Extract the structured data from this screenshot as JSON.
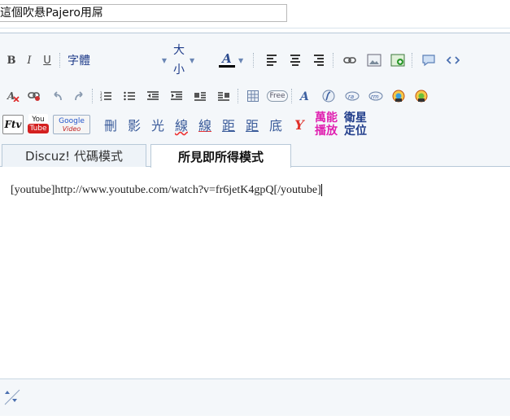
{
  "subject": {
    "value": "這個吹悬Pajero用屌"
  },
  "toolbar": {
    "bold": "B",
    "italic": "I",
    "underline": "U",
    "font_label": "字體",
    "size_label_1": "大",
    "size_label_2": "小",
    "font_color_letter": "A",
    "flash_label": "Ftv",
    "youtube_label_1": "You",
    "youtube_label_2": "Tube",
    "google_label_1": "Google",
    "google_label_2": "Video",
    "row3_chars": [
      "刪",
      "影",
      "光",
      "線",
      "線",
      "距",
      "距",
      "底"
    ],
    "y_label": "Y",
    "universal_label_1": "萬能",
    "universal_label_2": "播放",
    "satellite_label_1": "衛星",
    "satellite_label_2": "定位",
    "free_label": "Free",
    "colors": {
      "accent": "#2e4d8f",
      "magenta": "#e020b0",
      "cjk_blue": "#1f3c8a"
    }
  },
  "tabs": {
    "code_mode": "Discuz! 代碼模式",
    "wysiwyg_mode": "所見即所得模式"
  },
  "editor": {
    "content": "[youtube]http://www.youtube.com/watch?v=fr6jetK4gpQ[/youtube]"
  }
}
